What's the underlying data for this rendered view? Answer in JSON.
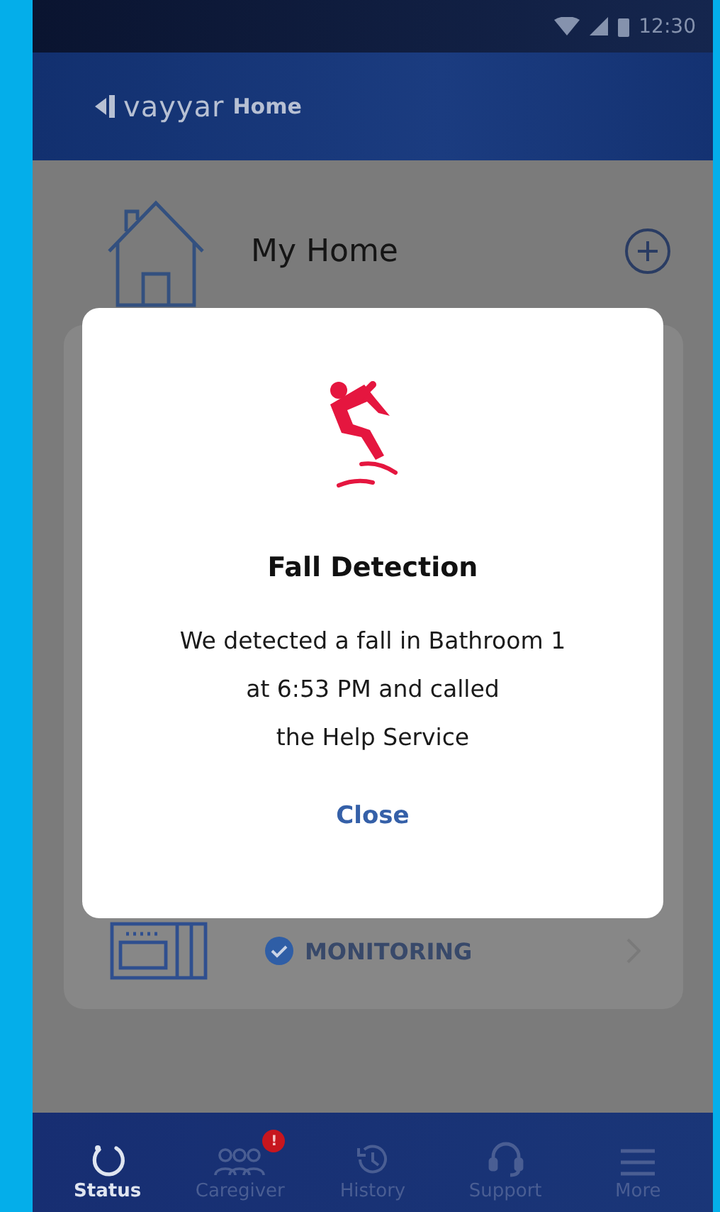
{
  "status_bar": {
    "time": "12:30"
  },
  "app_bar": {
    "logo_text": "vayyar",
    "title": "Home"
  },
  "home": {
    "title": "My Home"
  },
  "room_card": {
    "status": "MONITORING",
    "monitoring": true
  },
  "dialog": {
    "title": "Fall Detection",
    "message_lines": [
      "We detected a fall in Bathroom 1",
      "at 6:53 PM and called",
      "the Help Service"
    ],
    "button": "Close"
  },
  "nav": [
    {
      "kind": "status",
      "label": "Status",
      "selected": true
    },
    {
      "kind": "caregiver",
      "label": "Caregiver",
      "selected": false,
      "badge": "!"
    },
    {
      "kind": "history",
      "label": "History",
      "selected": false
    },
    {
      "kind": "support",
      "label": "Support",
      "selected": false
    },
    {
      "kind": "more",
      "label": "More",
      "selected": false
    }
  ]
}
